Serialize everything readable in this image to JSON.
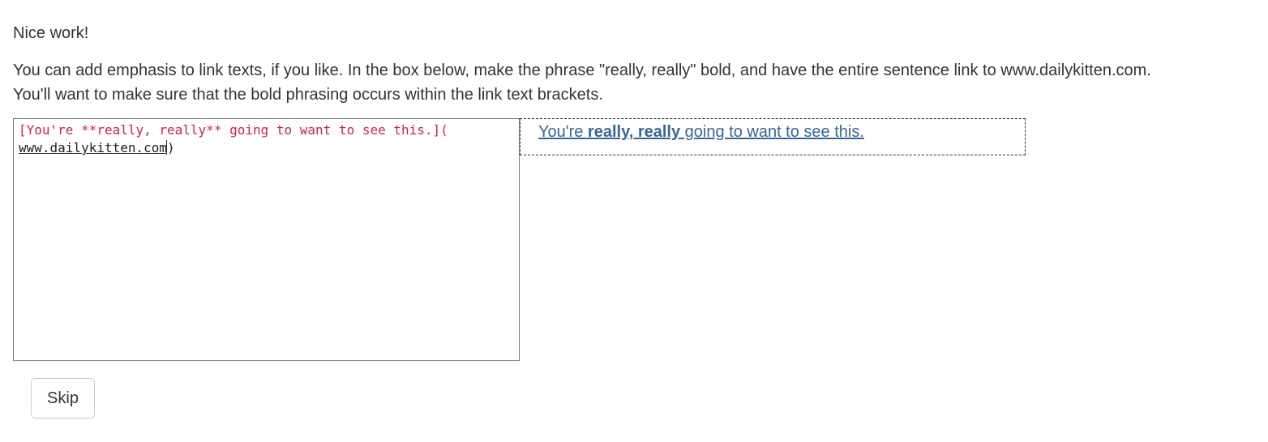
{
  "feedback": {
    "text": "Nice work!"
  },
  "instructions": {
    "line1": "You can add emphasis to link texts, if you like. In the box below, make the phrase \"really, really\" bold, and have the entire sentence link to www.dailykitten.com.",
    "line2": "You'll want to make sure that the bold phrasing occurs within the link text brackets."
  },
  "editor": {
    "line1_text": "[You're **really, really** going to want to see this.](",
    "line2_url": "www.dailykitten.com",
    "line2_close": ")"
  },
  "preview": {
    "before": "You're ",
    "bold": "really, really",
    "after": " going to want to see this."
  },
  "buttons": {
    "skip": "Skip"
  },
  "colors": {
    "text": "#333333",
    "markdown_token": "#c7254e",
    "link": "#3a6591",
    "editor_border": "#7a7a7a",
    "preview_border": "#333333"
  }
}
